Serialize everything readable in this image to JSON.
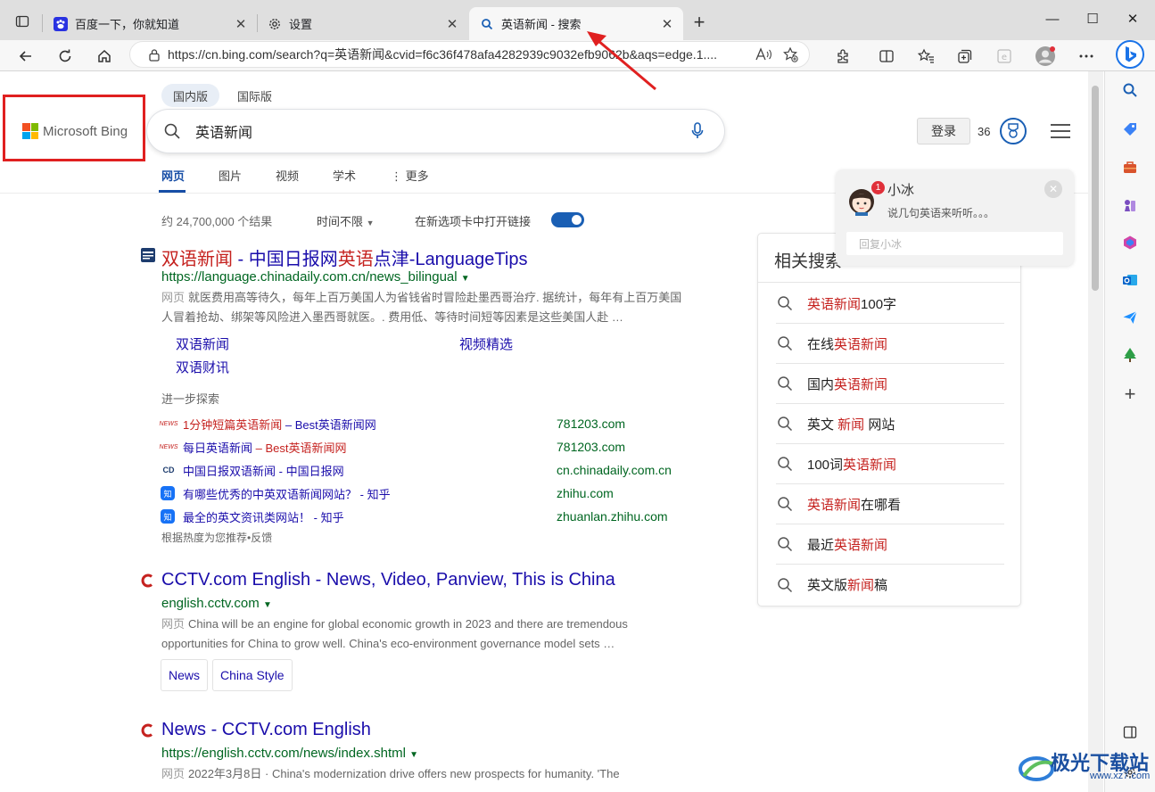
{
  "browser": {
    "tabs": [
      {
        "title": "百度一下，你就知道",
        "active": false,
        "icon": "baidu-paw-icon"
      },
      {
        "title": "设置",
        "active": false,
        "icon": "gear-icon"
      },
      {
        "title": "英语新闻 - 搜索",
        "active": true,
        "icon": "search-icon"
      }
    ],
    "address": {
      "url": "https://cn.bing.com/search?q=英语新闻&cvid=f6c36f478afa4282939c9032efb9062b&aqs=edge.1....",
      "read_aloud_label": "A͈"
    }
  },
  "bing": {
    "logo_text": "Microsoft Bing",
    "scopes": [
      "国内版",
      "国际版"
    ],
    "query": "英语新闻",
    "login_label": "登录",
    "points": "36",
    "nav_tabs": [
      "网页",
      "图片",
      "视频",
      "学术",
      "更多"
    ],
    "nav_more_prefix": "⋮",
    "result_count": "约 24,700,000 个结果",
    "time_filter": "时间不限",
    "open_new_tab_label": "在新选项卡中打开链接",
    "results": [
      {
        "title_parts": [
          "双语新闻",
          " - 中国日报网",
          "英语",
          "点津-LanguageTips"
        ],
        "url": "https://language.chinadaily.com.cn/news_bilingual",
        "snippet_label": "网页",
        "snippet_line1": "就医费用高等待久，每年上百万美国人为省钱省时冒险赴墨西哥治疗. 据统计，每年有上百万美国",
        "snippet_line2": "人冒着抢劫、绑架等风险进入墨西哥就医。. 费用低、等待时间短等因素是这些美国人赴 …",
        "sublinks": [
          "双语新闻",
          "视频精选",
          "双语财讯"
        ]
      },
      {
        "title": "CCTV.com English - News, Video, Panview, This is China",
        "url": "english.cctv.com",
        "snippet_label": "网页",
        "snippet_line1": "China will be an engine for global economic growth in 2023 and there are tremendous",
        "snippet_line2": "opportunities for China to grow well. China's eco-environment governance model sets …",
        "chips": [
          "News",
          "China Style"
        ]
      },
      {
        "title": "News - CCTV.com English",
        "url": "https://english.cctv.com/news/index.shtml",
        "snippet_label": "网页",
        "snippet_line1": "2022年3月8日 · China's modernization drive offers new prospects for humanity. 'The"
      }
    ],
    "explore": {
      "heading": "进一步探索",
      "items": [
        {
          "title_hl": "1分钟短篇英语新闻",
          "title_rest": " – Best英语新闻网",
          "domain": "781203.com",
          "icon": "news-icon"
        },
        {
          "title_hl": "每日英语新闻",
          "title_rest": " – Best英语新闻网",
          "domain": "781203.com",
          "icon": "news-icon"
        },
        {
          "title_hl": "中国日报双语新闻",
          "title_rest": " - 中国日报网",
          "domain": "cn.chinadaily.com.cn",
          "icon": "chinadaily-icon"
        },
        {
          "title_hl": "有哪些优秀的中英双语新闻网站？",
          "title_rest": " - 知乎",
          "domain": "zhihu.com",
          "icon": "zhihu-icon"
        },
        {
          "title_hl": "最全的英文资讯类网站！",
          "title_rest": " - 知乎",
          "domain": "zhuanlan.zhihu.com",
          "icon": "zhihu-icon"
        }
      ],
      "footer": "根据热度为您推荐•反馈",
      "news_icon_text": "NEWS",
      "zhihu_icon_text": "知",
      "cd_icon_text": "CD"
    },
    "related": {
      "title": "相关搜索",
      "items": [
        {
          "parts": [
            [
              "英语新闻",
              true
            ],
            [
              "100字",
              false
            ]
          ]
        },
        {
          "parts": [
            [
              "在线",
              false
            ],
            [
              "英语新闻",
              true
            ]
          ]
        },
        {
          "parts": [
            [
              "国内",
              false
            ],
            [
              "英语新闻",
              true
            ]
          ]
        },
        {
          "parts": [
            [
              "英文 ",
              false
            ],
            [
              "新闻",
              true
            ],
            [
              " 网站",
              false
            ]
          ]
        },
        {
          "parts": [
            [
              "100词",
              false
            ],
            [
              "英语新闻",
              true
            ]
          ]
        },
        {
          "parts": [
            [
              "英语新闻",
              true
            ],
            [
              "在哪看",
              false
            ]
          ]
        },
        {
          "parts": [
            [
              "最近",
              false
            ],
            [
              "英语新闻",
              true
            ]
          ]
        },
        {
          "parts": [
            [
              "英文版",
              false
            ],
            [
              "新闻",
              true
            ],
            [
              "稿",
              false
            ]
          ]
        }
      ]
    },
    "xiaobing": {
      "badge": "1",
      "name": "小冰",
      "message": "说几句英语来听听。。。",
      "reply_placeholder": "回复小冰"
    }
  },
  "watermark": {
    "brand": "极光下载站",
    "domain": "www.xz7.com"
  },
  "colors": {
    "link": "#1a0dab",
    "highlight": "#c5221f",
    "url": "#006621",
    "annotation_red": "#e02020",
    "bing_blue": "#174ea6"
  }
}
